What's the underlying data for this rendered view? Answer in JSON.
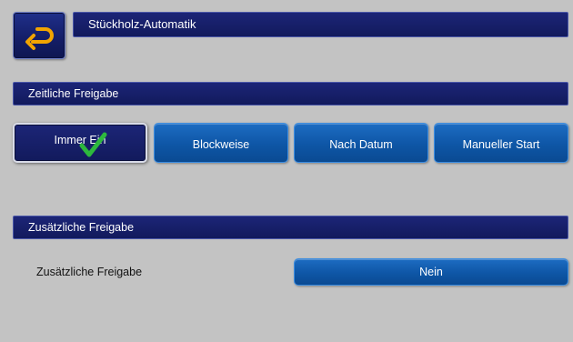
{
  "header": {
    "title": "Stückholz-Automatik",
    "back_icon": "back-arrow-icon"
  },
  "section_time": {
    "title": "Zeitliche Freigabe",
    "options": [
      {
        "label": "Immer Ein",
        "selected": true
      },
      {
        "label": "Blockweise",
        "selected": false
      },
      {
        "label": "Nach Datum",
        "selected": false
      },
      {
        "label": "Manueller Start",
        "selected": false
      }
    ]
  },
  "section_extra": {
    "title": "Zusätzliche Freigabe",
    "row_label": "Zusätzliche Freigabe",
    "row_value": "Nein"
  },
  "colors": {
    "background": "#c3c3c3",
    "dark_bar": "#141d66",
    "button_blue": "#0e56a6",
    "arrow_yellow": "#f2a400",
    "check_green": "#2db83d"
  }
}
